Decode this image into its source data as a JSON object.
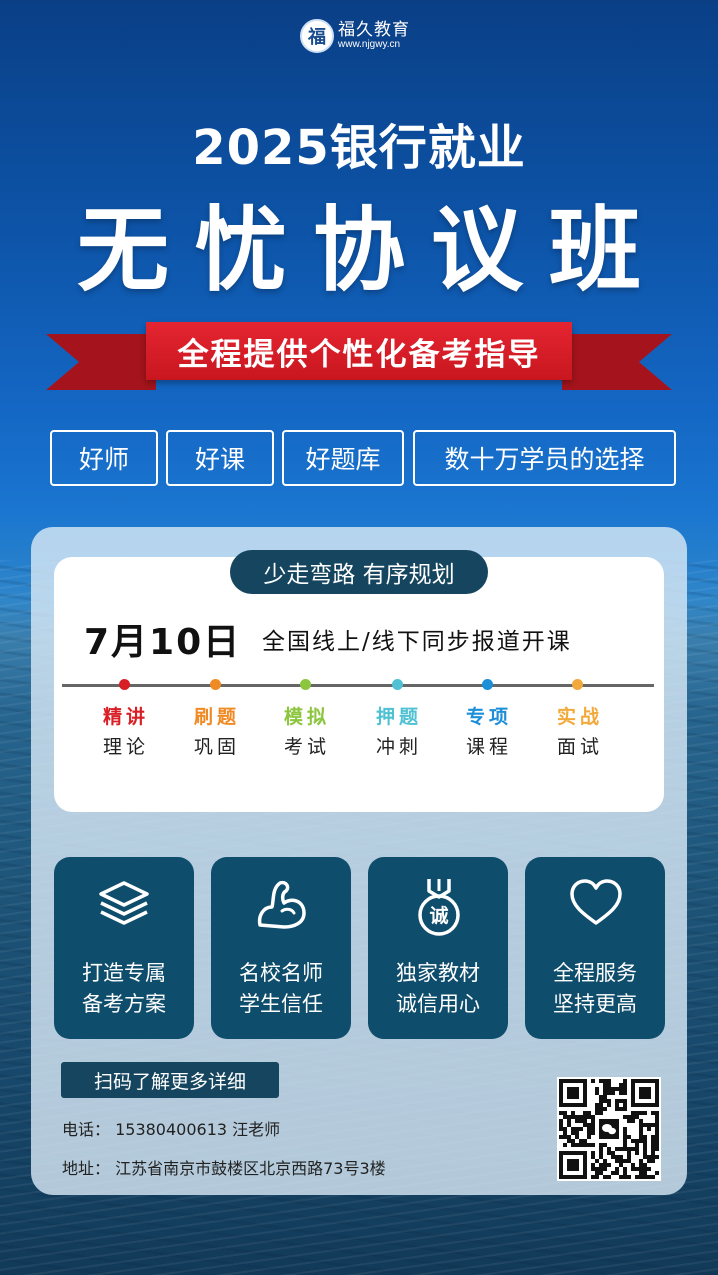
{
  "brand": {
    "mark": "福",
    "name": "福久教育",
    "url": "www.njgwy.cn"
  },
  "header": {
    "subtitle": "2025银行就业",
    "title": "无忧协议班"
  },
  "ribbon": {
    "text": "全程提供个性化备考指导"
  },
  "tags": [
    "好师",
    "好课",
    "好题库",
    "数十万学员的选择"
  ],
  "schedule": {
    "pill": "少走弯路 有序规划",
    "date": "7月10日",
    "description": "全国线上/线下同步报道开课",
    "stages": [
      {
        "top": "精讲",
        "bottom": "理论",
        "color": "#d81f26"
      },
      {
        "top": "刷题",
        "bottom": "巩固",
        "color": "#f08a24"
      },
      {
        "top": "模拟",
        "bottom": "考试",
        "color": "#8cc63f"
      },
      {
        "top": "押题",
        "bottom": "冲刺",
        "color": "#4fc1d3"
      },
      {
        "top": "专项",
        "bottom": "课程",
        "color": "#1c8fd8"
      },
      {
        "top": "实战",
        "bottom": "面试",
        "color": "#f2a93b"
      }
    ]
  },
  "features": [
    {
      "icon": "layers-icon",
      "line1": "打造专属",
      "line2": "备考方案"
    },
    {
      "icon": "muscle-arm-icon",
      "line1": "名校名师",
      "line2": "学生信任"
    },
    {
      "icon": "medal-icon",
      "medal_text": "诚",
      "line1": "独家教材",
      "line2": "诚信用心"
    },
    {
      "icon": "heart-icon",
      "line1": "全程服务",
      "line2": "坚持更高"
    }
  ],
  "contact": {
    "scan_label": "扫码了解更多详细",
    "phone": "电话： 15380400613    汪老师",
    "address": "地址： 江苏省南京市鼓楼区北京西路73号3楼"
  },
  "qr": {
    "icon": "wechat-qr-code"
  },
  "colors": {
    "red": "#d81f26",
    "navy": "#16465f",
    "card": "#0f4d6c"
  }
}
